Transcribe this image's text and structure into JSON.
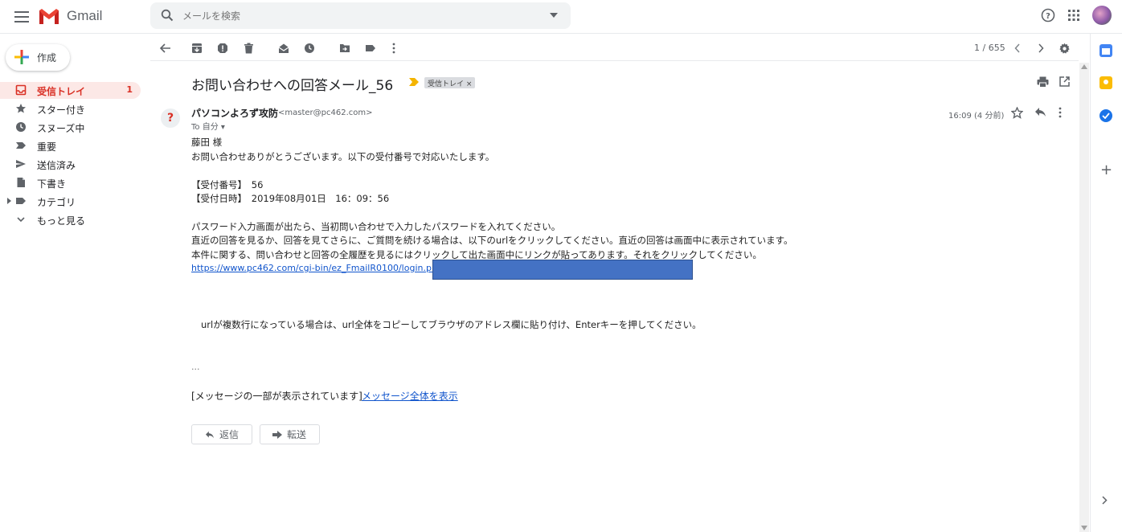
{
  "app": {
    "name": "Gmail"
  },
  "search": {
    "placeholder": "メールを検索"
  },
  "compose": {
    "label": "作成"
  },
  "sidebar": {
    "items": [
      {
        "label": "受信トレイ",
        "count": "1",
        "icon": "inbox-icon"
      },
      {
        "label": "スター付き",
        "icon": "star-icon"
      },
      {
        "label": "スヌーズ中",
        "icon": "clock-icon"
      },
      {
        "label": "重要",
        "icon": "importance-icon"
      },
      {
        "label": "送信済み",
        "icon": "send-icon"
      },
      {
        "label": "下書き",
        "icon": "draft-icon"
      },
      {
        "label": "カテゴリ",
        "icon": "label-icon"
      },
      {
        "label": "もっと見る",
        "icon": "chevron-down-icon"
      }
    ]
  },
  "toolbar": {
    "pager": "1 / 655"
  },
  "message": {
    "subject": "お問い合わせへの回答メール_56",
    "label_chip": "受信トレイ ×",
    "sender_avatar": "?",
    "sender_name": "パソコンよろず攻防",
    "sender_email": "<master@pc462.com>",
    "to_line": "To 自分 ▾",
    "time": "16:09 (4 分前)",
    "body": [
      "藤田 様",
      "お問い合わせありがとうございます。以下の受付番号で対応いたします。",
      "【受付番号】　56",
      "【受付日時】　2019年08月01日　16：09：56",
      "パスワード入力画面が出たら、当初問い合わせで入力したパスワードを入れてください。",
      "直近の回答を見るか、回答を見てさらに、ご質問を続ける場合は、以下のurlをクリックしてください。直近の回答は画面中に表示されています。",
      "本件に関する、問い合わせと回答の全履歴を見るにはクリックして出た画面中にリンクが貼ってあります。それをクリックしてください。",
      "urlが複数行になっている場合は、url全体をコピーしてブラウザのアドレス欄に貼り付け、Enterキーを押してください。"
    ],
    "link": "https://www.pc462.com/cgi-bin/ez_FmailR0100/login.php?",
    "ellipsis": "...",
    "clipped_text": "[メッセージの一部が表示されています]",
    "view_full": "メッセージ全体を表示",
    "reply_label": "返信",
    "forward_label": "転送"
  },
  "colors": {
    "accent_red": "#d93025",
    "link_blue": "#1155cc",
    "redaction": "#4472c4",
    "inbox_active_bg": "#fce8e6"
  }
}
